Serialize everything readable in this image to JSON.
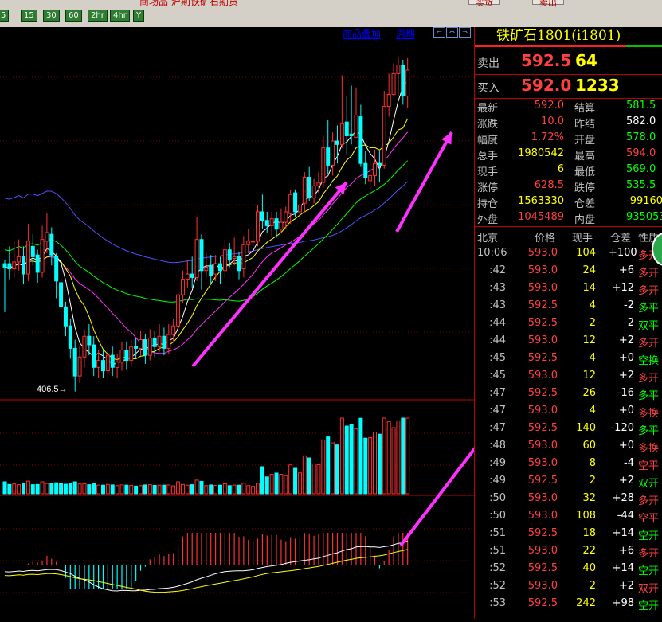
{
  "top": {
    "red_text": "商场品 沪期铁矿石期货",
    "buttons": [
      "买货",
      "卖出"
    ],
    "periods": [
      "5",
      "15",
      "30",
      "60",
      "2hr",
      "4hr",
      "Y"
    ]
  },
  "chart_links": {
    "overlay": "商品叠加",
    "period": "周期",
    "nav": [
      "⇐",
      "⇔",
      "⇒"
    ]
  },
  "chart_data": {
    "type": "candlestick",
    "low_label": "406.5→",
    "colors": {
      "up": "#ff3030",
      "down": "#00ffff",
      "ma5": "#ffffff",
      "ma10": "#ffff00",
      "ma20": "#ff30ff",
      "ma40": "#00ff00",
      "ma60": "#5050ff",
      "arrow": "#ff30ff"
    },
    "candles": [
      [
        480,
        478,
        482,
        452
      ],
      [
        480,
        477,
        490,
        471
      ],
      [
        477,
        481,
        493,
        472
      ],
      [
        481,
        484,
        494,
        476
      ],
      [
        484,
        474,
        490,
        468
      ],
      [
        474,
        493,
        503,
        470
      ],
      [
        490,
        484,
        497,
        479
      ],
      [
        485,
        475,
        488,
        469
      ],
      [
        475,
        494,
        502,
        472
      ],
      [
        493,
        498,
        509,
        486
      ],
      [
        497,
        485,
        501,
        479
      ],
      [
        484,
        470,
        486,
        460
      ],
      [
        469,
        455,
        472,
        449
      ],
      [
        455,
        444,
        458,
        438
      ],
      [
        444,
        431,
        448,
        425
      ],
      [
        431,
        415,
        436,
        406
      ],
      [
        415,
        426,
        432,
        411
      ],
      [
        426,
        438,
        442,
        420
      ],
      [
        438,
        433,
        445,
        427
      ],
      [
        433,
        420,
        438,
        415
      ],
      [
        420,
        424,
        430,
        414
      ],
      [
        424,
        418,
        430,
        414
      ],
      [
        418,
        427,
        432,
        413
      ],
      [
        427,
        420,
        432,
        415
      ],
      [
        420,
        423,
        428,
        414
      ],
      [
        423,
        430,
        435,
        418
      ],
      [
        430,
        424,
        435,
        419
      ],
      [
        424,
        432,
        436,
        421
      ],
      [
        432,
        431,
        437,
        425
      ],
      [
        431,
        436,
        441,
        427
      ],
      [
        436,
        427,
        439,
        422
      ],
      [
        427,
        437,
        442,
        424
      ],
      [
        437,
        432,
        441,
        426
      ],
      [
        432,
        438,
        445,
        429
      ],
      [
        438,
        431,
        443,
        427
      ],
      [
        431,
        439,
        445,
        428
      ],
      [
        439,
        444,
        448,
        435
      ],
      [
        444,
        462,
        470,
        440
      ],
      [
        462,
        471,
        476,
        457
      ],
      [
        471,
        474,
        482,
        466
      ],
      [
        474,
        472,
        484,
        466
      ],
      [
        472,
        494,
        507,
        470
      ],
      [
        494,
        476,
        497,
        465
      ],
      [
        476,
        478,
        486,
        472
      ],
      [
        479,
        473,
        485,
        468
      ],
      [
        474,
        480,
        485,
        470
      ],
      [
        480,
        476,
        484,
        468
      ],
      [
        476,
        488,
        494,
        472
      ],
      [
        488,
        482,
        492,
        478
      ],
      [
        483,
        484,
        495,
        479
      ],
      [
        484,
        476,
        487,
        471
      ],
      [
        477,
        491,
        496,
        472
      ],
      [
        491,
        493,
        500,
        486
      ],
      [
        493,
        493,
        501,
        490
      ],
      [
        493,
        510,
        514,
        490
      ],
      [
        510,
        505,
        520,
        500
      ],
      [
        505,
        502,
        510,
        498
      ],
      [
        502,
        506,
        510,
        496
      ],
      [
        506,
        500,
        510,
        495
      ],
      [
        500,
        504,
        512,
        498
      ],
      [
        504,
        510,
        513,
        500
      ],
      [
        509,
        520,
        523,
        503
      ],
      [
        521,
        510,
        523,
        507
      ],
      [
        510,
        514,
        519,
        508
      ],
      [
        515,
        530,
        533,
        510
      ],
      [
        530,
        518,
        536,
        516
      ],
      [
        518,
        525,
        529,
        515
      ],
      [
        525,
        527,
        533,
        521
      ],
      [
        527,
        547,
        554,
        524
      ],
      [
        547,
        537,
        563,
        532
      ],
      [
        537,
        551,
        556,
        531
      ],
      [
        551,
        549,
        560,
        538
      ],
      [
        549,
        561,
        589,
        547
      ],
      [
        562,
        554,
        577,
        543
      ],
      [
        555,
        554,
        583,
        549
      ],
      [
        553,
        566,
        582,
        553
      ],
      [
        565,
        538,
        572,
        536
      ],
      [
        538,
        530,
        545,
        526
      ],
      [
        528,
        531,
        540,
        522
      ],
      [
        531,
        538,
        546,
        525
      ],
      [
        538,
        537,
        545,
        527
      ],
      [
        537,
        571,
        580,
        535
      ],
      [
        571,
        578,
        590,
        565
      ],
      [
        578,
        590,
        596,
        577
      ],
      [
        590,
        595,
        600,
        577
      ],
      [
        595,
        577,
        598,
        572
      ],
      [
        577,
        592,
        599,
        570
      ]
    ]
  },
  "instrument": {
    "title": "铁矿石1801(i1801)"
  },
  "quote": {
    "sell_label": "卖出",
    "sell_price": "592.5",
    "sell_vol": "64",
    "buy_label": "买入",
    "buy_price": "592.0",
    "buy_vol": "1233"
  },
  "stats": [
    {
      "l1": "最新",
      "v1": "592.0",
      "c1": "#ff4040",
      "l2": "结算",
      "v2": "581.5",
      "c2": "#00ff00"
    },
    {
      "l1": "涨跌",
      "v1": "10.0",
      "c1": "#ff4040",
      "l2": "昨结",
      "v2": "582.0",
      "c2": "#ffffff"
    },
    {
      "l1": "幅度",
      "v1": "1.72%",
      "c1": "#ff4040",
      "l2": "开盘",
      "v2": "578.0",
      "c2": "#00ff00"
    },
    {
      "l1": "总手",
      "v1": "1980542",
      "c1": "#ffff00",
      "l2": "最高",
      "v2": "594.0",
      "c2": "#ff4040"
    },
    {
      "l1": "现手",
      "v1": "6",
      "c1": "#ffff00",
      "l2": "最低",
      "v2": "569.0",
      "c2": "#00ff00"
    },
    {
      "l1": "涨停",
      "v1": "628.5",
      "c1": "#ff4040",
      "l2": "跌停",
      "v2": "535.5",
      "c2": "#00ff00"
    },
    {
      "l1": "持仓",
      "v1": "1563330",
      "c1": "#ffff00",
      "l2": "仓差",
      "v2": "-99160",
      "c2": "#ffff00"
    },
    {
      "l1": "外盘",
      "v1": "1045489",
      "c1": "#ff4040",
      "l2": "内盘",
      "v2": "935053",
      "c2": "#00ff00"
    }
  ],
  "table": {
    "headers": [
      "北京",
      "价格",
      "现手",
      "仓差",
      "性质"
    ],
    "rows": [
      {
        "t": "10:06",
        "p": "593.0",
        "pc": "#ff4040",
        "v": "104",
        "c": "+100",
        "n": "多开",
        "nc": "#ff4040"
      },
      {
        "t": ":42",
        "p": "593.0",
        "pc": "#ff4040",
        "v": "24",
        "c": "+6",
        "n": "多开",
        "nc": "#ff4040"
      },
      {
        "t": ":43",
        "p": "593.0",
        "pc": "#ff4040",
        "v": "14",
        "c": "+12",
        "n": "多开",
        "nc": "#ff4040"
      },
      {
        "t": ":43",
        "p": "592.5",
        "pc": "#ff4040",
        "v": "4",
        "c": "-2",
        "n": "多平",
        "nc": "#00ff00"
      },
      {
        "t": ":44",
        "p": "592.5",
        "pc": "#ff4040",
        "v": "2",
        "c": "-2",
        "n": "双平",
        "nc": "#00ff00"
      },
      {
        "t": ":44",
        "p": "593.0",
        "pc": "#ff4040",
        "v": "12",
        "c": "+2",
        "n": "多开",
        "nc": "#ff4040"
      },
      {
        "t": ":45",
        "p": "592.5",
        "pc": "#ff4040",
        "v": "4",
        "c": "+0",
        "n": "空换",
        "nc": "#00ff00"
      },
      {
        "t": ":45",
        "p": "593.0",
        "pc": "#ff4040",
        "v": "12",
        "c": "+2",
        "n": "多开",
        "nc": "#ff4040"
      },
      {
        "t": ":47",
        "p": "592.5",
        "pc": "#ff4040",
        "v": "26",
        "c": "-16",
        "n": "多平",
        "nc": "#00ff00"
      },
      {
        "t": ":47",
        "p": "593.0",
        "pc": "#ff4040",
        "v": "4",
        "c": "+0",
        "n": "多换",
        "nc": "#ff4040"
      },
      {
        "t": ":47",
        "p": "592.5",
        "pc": "#ff4040",
        "v": "140",
        "c": "-120",
        "n": "多平",
        "nc": "#00ff00"
      },
      {
        "t": ":48",
        "p": "593.0",
        "pc": "#ff4040",
        "v": "60",
        "c": "+0",
        "n": "多换",
        "nc": "#ff4040"
      },
      {
        "t": ":49",
        "p": "593.0",
        "pc": "#ff4040",
        "v": "8",
        "c": "-4",
        "n": "空平",
        "nc": "#ff4040"
      },
      {
        "t": ":49",
        "p": "592.5",
        "pc": "#ff4040",
        "v": "2",
        "c": "+2",
        "n": "双开",
        "nc": "#00ff00"
      },
      {
        "t": ":50",
        "p": "593.0",
        "pc": "#ff4040",
        "v": "32",
        "c": "+28",
        "n": "多开",
        "nc": "#ff4040"
      },
      {
        "t": ":50",
        "p": "593.0",
        "pc": "#ff4040",
        "v": "108",
        "c": "-44",
        "n": "空平",
        "nc": "#ff4040"
      },
      {
        "t": ":51",
        "p": "592.5",
        "pc": "#ff4040",
        "v": "18",
        "c": "+14",
        "n": "空开",
        "nc": "#00ff00"
      },
      {
        "t": ":51",
        "p": "593.0",
        "pc": "#ff4040",
        "v": "22",
        "c": "+6",
        "n": "多开",
        "nc": "#ff4040"
      },
      {
        "t": ":52",
        "p": "592.5",
        "pc": "#ff4040",
        "v": "40",
        "c": "+14",
        "n": "空开",
        "nc": "#00ff00"
      },
      {
        "t": ":52",
        "p": "593.0",
        "pc": "#ff4040",
        "v": "2",
        "c": "+2",
        "n": "双开",
        "nc": "#ff4040"
      },
      {
        "t": ":53",
        "p": "592.5",
        "pc": "#ff4040",
        "v": "242",
        "c": "+98",
        "n": "空开",
        "nc": "#00ff00"
      }
    ]
  }
}
